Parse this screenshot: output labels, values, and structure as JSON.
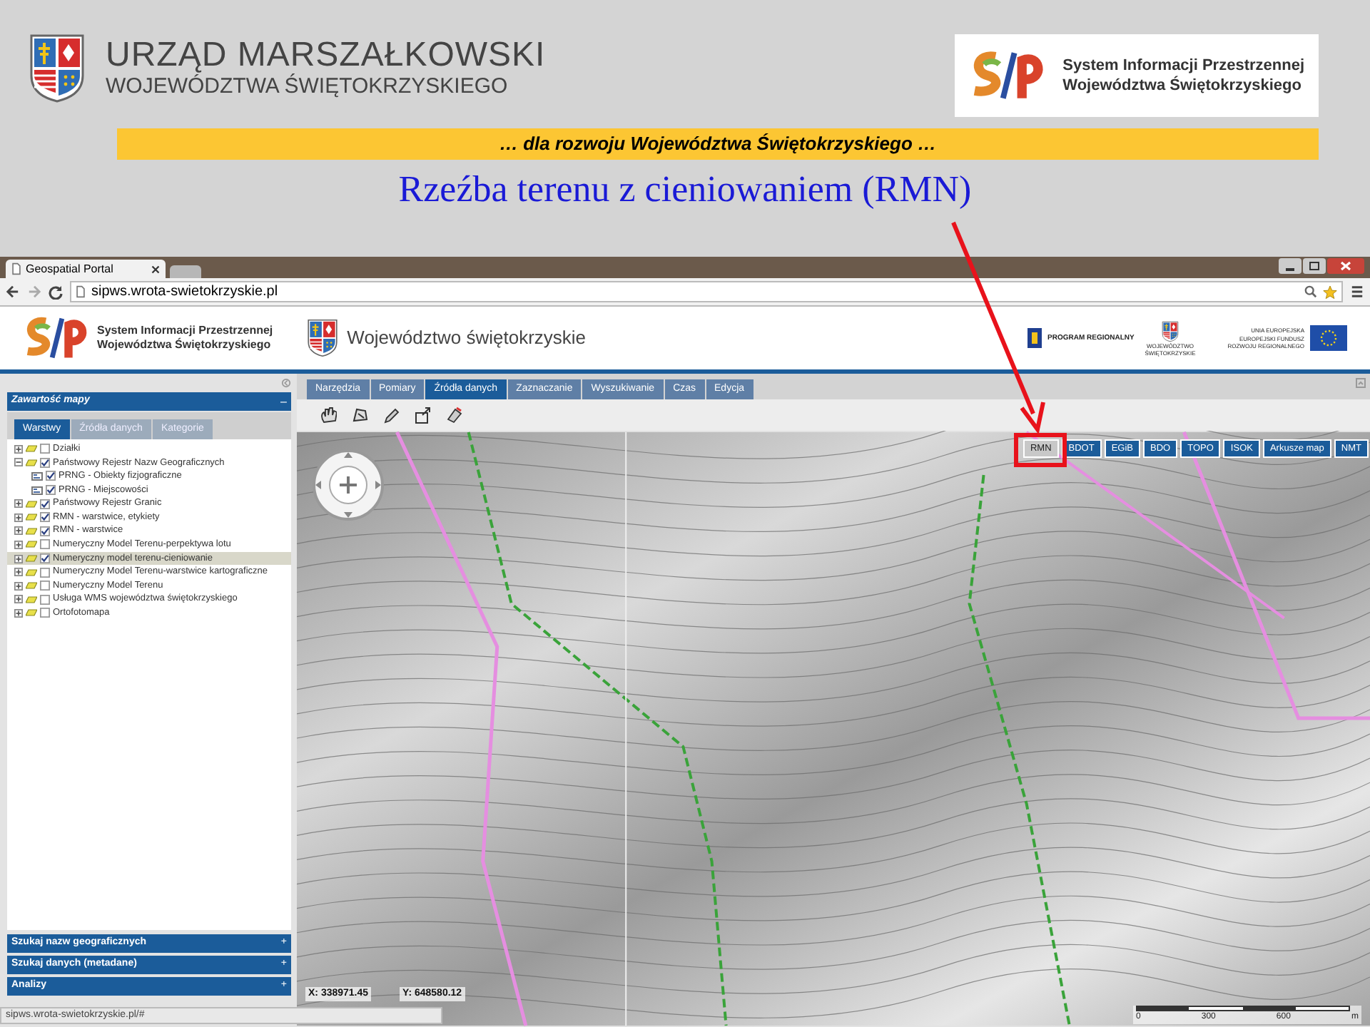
{
  "slide": {
    "org_title": "URZĄD MARSZAŁKOWSKI",
    "org_subtitle": "WOJEWÓDZTWA ŚWIĘTOKRZYSKIEGO",
    "sip_lines": [
      "System Informacji Przestrzennej",
      "Województwa Świętokrzyskiego"
    ],
    "slogan": "… dla rozwoju Województwa Świętokrzyskiego …",
    "title": "Rzeźba terenu z cieniowaniem (RMN)"
  },
  "browser": {
    "tab_title": "Geospatial Portal",
    "url": "sipws.wrota-swietokrzyskie.pl",
    "status_url": "sipws.wrota-swietokrzyskie.pl/#"
  },
  "app_header": {
    "sip_lines": [
      "System Informacji Przestrzennej",
      "Województwa Świętokrzyskiego"
    ],
    "region_name": "Województwo świętokrzyskie",
    "partner_texts": [
      "PROGRAM REGIONALNY",
      "WOJEWÓDZTWO ŚWIĘTOKRZYSKIE",
      "UNIA EUROPEJSKA",
      "EUROPEJSKI FUNDUSZ ROZWOJU REGIONALNEGO"
    ]
  },
  "sidebar": {
    "panel_title": "Zawartość mapy",
    "panel_toggle": "–",
    "tabs": [
      {
        "label": "Warstwy",
        "selected": true
      },
      {
        "label": "Źródła danych",
        "selected": false
      },
      {
        "label": "Kategorie",
        "selected": false
      }
    ],
    "layers": [
      {
        "label": "Działki",
        "checked": false,
        "expanded": false,
        "selected": false
      },
      {
        "label": "Państwowy Rejestr Nazw Geograficznych",
        "checked": true,
        "expanded": true,
        "selected": false,
        "children": [
          {
            "label": "PRNG - Obiekty fizjograficzne",
            "checked": true,
            "selected": false
          },
          {
            "label": "PRNG - Miejscowości",
            "checked": true,
            "selected": false
          }
        ]
      },
      {
        "label": "Państwowy Rejestr Granic",
        "checked": true,
        "expanded": false,
        "selected": false
      },
      {
        "label": "RMN - warstwice, etykiety",
        "checked": true,
        "expanded": false,
        "selected": false
      },
      {
        "label": "RMN - warstwice",
        "checked": true,
        "expanded": false,
        "selected": false
      },
      {
        "label": "Numeryczny Model Terenu-perpektywa lotu",
        "checked": false,
        "expanded": false,
        "selected": false
      },
      {
        "label": "Numeryczny model terenu-cieniowanie",
        "checked": true,
        "expanded": false,
        "selected": true
      },
      {
        "label": "Numeryczny Model Terenu-warstwice kartograficzne",
        "checked": false,
        "expanded": false,
        "selected": false
      },
      {
        "label": "Numeryczny Model Terenu",
        "checked": false,
        "expanded": false,
        "selected": false
      },
      {
        "label": "Usługa WMS województwa świętokrzyskiego",
        "checked": false,
        "expanded": false,
        "selected": false
      },
      {
        "label": "Ortofotomapa",
        "checked": false,
        "expanded": false,
        "selected": false
      }
    ],
    "sections": [
      {
        "title": "Szukaj nazw geograficznych",
        "toggle": "+"
      },
      {
        "title": "Szukaj danych (metadane)",
        "toggle": "+"
      },
      {
        "title": "Analizy",
        "toggle": "+"
      }
    ]
  },
  "toolbar": {
    "tabs": [
      {
        "label": "Narzędzia",
        "selected": false
      },
      {
        "label": "Pomiary",
        "selected": false
      },
      {
        "label": "Źródła danych",
        "selected": true
      },
      {
        "label": "Zaznaczanie",
        "selected": false
      },
      {
        "label": "Wyszukiwanie",
        "selected": false
      },
      {
        "label": "Czas",
        "selected": false
      },
      {
        "label": "Edycja",
        "selected": false
      }
    ]
  },
  "map": {
    "layer_buttons": [
      {
        "label": "RMN",
        "selected": true
      },
      {
        "label": "BDOT",
        "selected": false
      },
      {
        "label": "EGiB",
        "selected": false
      },
      {
        "label": "BDO",
        "selected": false
      },
      {
        "label": "TOPO",
        "selected": false
      },
      {
        "label": "ISOK",
        "selected": false
      },
      {
        "label": "Arkusze map",
        "selected": false
      },
      {
        "label": "NMT",
        "selected": false
      }
    ],
    "coordinates": [
      "X: 338971.45",
      "Y: 648580.12"
    ],
    "scale_labels": [
      "0",
      "300",
      "600",
      "m"
    ]
  }
}
